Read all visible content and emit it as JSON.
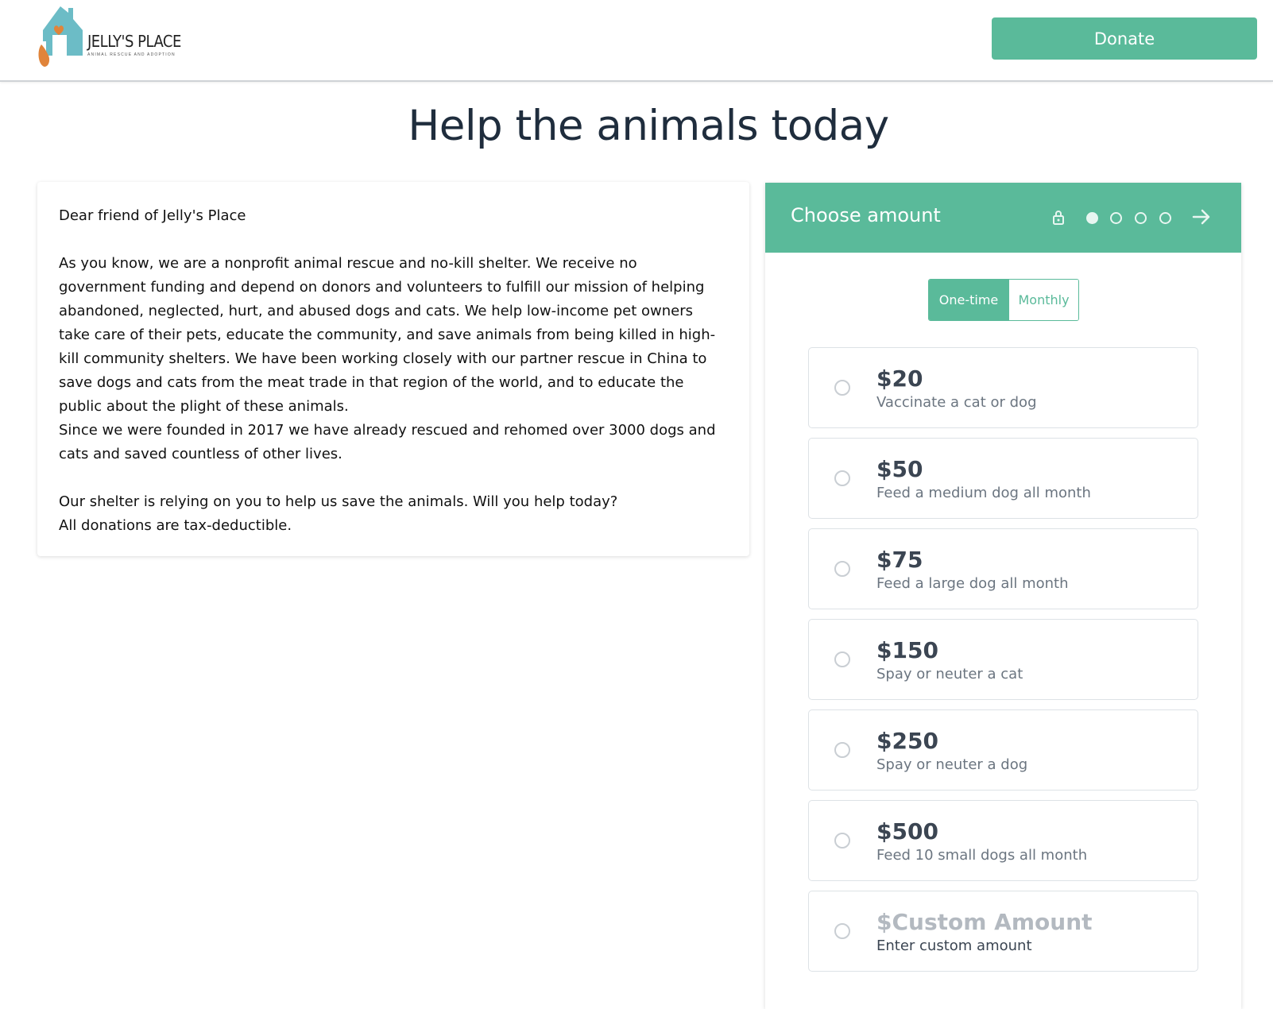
{
  "header": {
    "logo_text": "JELLY'S PLACE",
    "logo_subtext": "animal rescue and adoption",
    "donate_label": "Donate"
  },
  "page_title": "Help the animals today",
  "letter": {
    "greeting": "Dear friend of Jelly's Place",
    "paragraph1": "As you know, we are a nonprofit animal rescue and no-kill shelter. We receive no government funding and depend on donors and volunteers to fulfill our mission of helping abandoned, neglected, hurt, and abused dogs and cats. We help low-income pet owners take care of their pets, educate the community, and save animals from being killed in high-kill community shelters. We have been working closely with our partner rescue in China to save dogs and cats from the meat trade in that region of the world, and to educate the public about the plight of these animals.",
    "paragraph2": "Since we were founded in 2017 we have already rescued and rehomed over 3000 dogs and cats and saved countless of other lives.",
    "paragraph3": "Our shelter is relying on you to help us save the animals. Will you help today?",
    "paragraph4": "All donations are tax-deductible."
  },
  "panel": {
    "title": "Choose amount",
    "step_current": 1,
    "step_total": 4,
    "frequency": {
      "one_time": "One-time",
      "monthly": "Monthly",
      "selected": "One-time"
    },
    "options": [
      {
        "amount": "$20",
        "desc": "Vaccinate a cat or dog"
      },
      {
        "amount": "$50",
        "desc": "Feed a medium dog all month"
      },
      {
        "amount": "$75",
        "desc": "Feed a large dog all month"
      },
      {
        "amount": "$150",
        "desc": "Spay or neuter a cat"
      },
      {
        "amount": "$250",
        "desc": "Spay or neuter a dog"
      },
      {
        "amount": "$500",
        "desc": "Feed 10 small dogs all month"
      },
      {
        "amount": "$Custom Amount",
        "desc": "Enter custom amount"
      }
    ]
  },
  "colors": {
    "accent": "#5aba9a",
    "title_text": "#1f2d3d",
    "amount_text": "#3b4552",
    "custom_amount_text": "#b3b9c0"
  }
}
